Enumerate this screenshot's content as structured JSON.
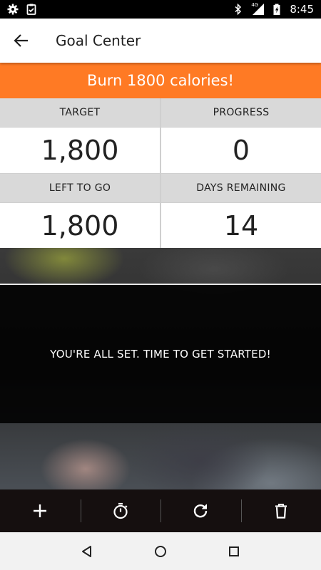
{
  "status_bar": {
    "time": "8:45",
    "network_label": "4G",
    "icons": [
      "settings-icon",
      "clipboard-check-icon",
      "bluetooth-icon",
      "signal-icon",
      "battery-icon"
    ]
  },
  "app_bar": {
    "title": "Goal Center",
    "back_icon": "arrow-back-icon"
  },
  "goal": {
    "banner_text": "Burn 1800 calories!",
    "accent_color": "#ff7a24"
  },
  "stats": [
    {
      "label": "TARGET",
      "value": "1,800"
    },
    {
      "label": "PROGRESS",
      "value": "0"
    },
    {
      "label": "LEFT TO GO",
      "value": "1,800"
    },
    {
      "label": "DAYS REMAINING",
      "value": "14"
    }
  ],
  "message": "YOU'RE ALL SET. TIME TO GET STARTED!",
  "actions": [
    {
      "name": "add",
      "icon": "plus-icon"
    },
    {
      "name": "timer",
      "icon": "stopwatch-icon"
    },
    {
      "name": "refresh",
      "icon": "refresh-icon"
    },
    {
      "name": "delete",
      "icon": "trash-icon"
    }
  ],
  "nav": [
    "back-triangle-icon",
    "home-circle-icon",
    "recents-square-icon"
  ]
}
